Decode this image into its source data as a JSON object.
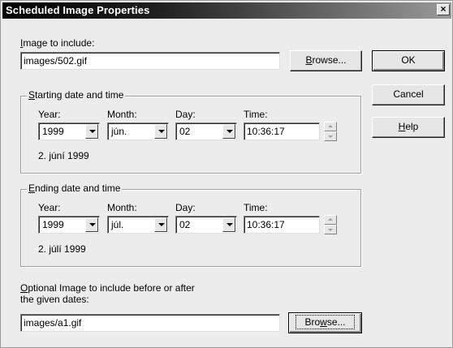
{
  "window": {
    "title": "Scheduled Image Properties",
    "close_glyph": "×"
  },
  "image": {
    "label_u": "I",
    "label_rest": "mage to include:",
    "value": "images/502.gif",
    "browse_u": "B",
    "browse_rest": "rowse..."
  },
  "buttons": {
    "ok": "OK",
    "cancel": "Cancel",
    "help_u": "H",
    "help_rest": "elp"
  },
  "start": {
    "title_u": "S",
    "title_rest": "tarting date and time",
    "year_label": "Year:",
    "month_label": "Month:",
    "day_label": "Day:",
    "time_label": "Time:",
    "year": "1999",
    "month": "jún.",
    "day": "02",
    "time": "10:36:17",
    "summary": "2. júní 1999"
  },
  "end": {
    "title_u": "E",
    "title_rest": "nding date and time",
    "year_label": "Year:",
    "month_label": "Month:",
    "day_label": "Day:",
    "time_label": "Time:",
    "year": "1999",
    "month": "júl.",
    "day": "02",
    "time": "10:36:17",
    "summary": "2. júlí 1999"
  },
  "optional": {
    "label_line1_u": "O",
    "label_line1_rest": "ptional Image to include before or after",
    "label_line2": "the given dates:",
    "value": "images/a1.gif",
    "browse_pre": "Bro",
    "browse_u": "w",
    "browse_rest": "se..."
  }
}
